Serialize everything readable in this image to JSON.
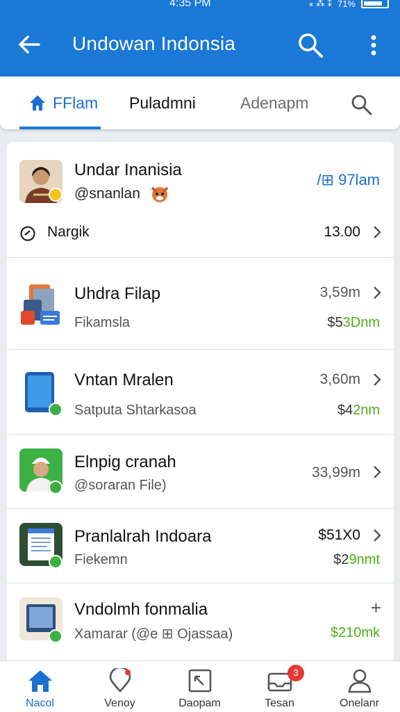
{
  "status_bar": {
    "time": "4:35 PM",
    "signal": "⁎ ⁂ ⁑",
    "battery_text": "71%"
  },
  "app_bar": {
    "title": "Undowan Indonsia"
  },
  "tabs": [
    {
      "label": "FFlam"
    },
    {
      "label": "Puladmni"
    },
    {
      "label": "Adenapm"
    }
  ],
  "colors": {
    "primary": "#1a78d6",
    "accent_green": "#4caf1a",
    "badge_red": "#e53935"
  },
  "list": [
    {
      "name": "Undar Inanisia",
      "handle": "@snanlan",
      "tag": "/⊞ 97lam",
      "meta_label": "Nargik",
      "meta_value": "13.00",
      "icon": "avatar-icon"
    },
    {
      "name": "Uhdra Filap",
      "sub": "Fikamsla",
      "value": "3,59m",
      "price_a": "$5",
      "price_b": "3Dnm",
      "icon": "apps-icon"
    },
    {
      "name": "Vntan Mralen",
      "sub": "Satputa Shtarkasoa",
      "value": "3,60m",
      "price_a": "$4",
      "price_b": "2nm",
      "icon": "tablet-icon"
    },
    {
      "name": "Elnpig cranah",
      "sub": "@soraran File)",
      "value": "33,99m",
      "icon": "avatar-icon"
    },
    {
      "name": "Pranlalrah Indoara",
      "sub": "Fiekemn",
      "value": "$51X0",
      "price_a": "$2",
      "price_b": "9nmt",
      "icon": "document-icon"
    },
    {
      "name": "Vndolmh fonmalia",
      "sub": "Xamarar (@e ⊞ Ojassaa)",
      "value": "+",
      "price_a": "",
      "price_b": "$210mk",
      "icon": "tablet-icon"
    }
  ],
  "bottom_nav": [
    {
      "label": "Nacol"
    },
    {
      "label": "Venoy"
    },
    {
      "label": "Daopam"
    },
    {
      "label": "Tesan",
      "badge": "3"
    },
    {
      "label": "Onelanr"
    }
  ]
}
